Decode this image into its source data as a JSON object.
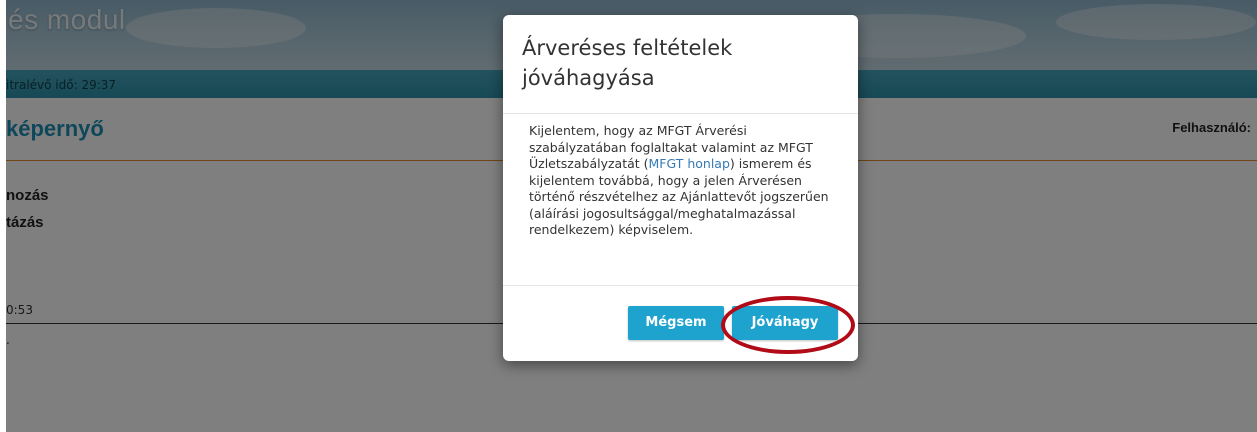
{
  "app": {
    "banner_title": "és modul",
    "timer_text": "itralévő idő: 29:37",
    "page_title": "képernyő",
    "user_label": "Felhasználó:"
  },
  "menu": {
    "items": [
      {
        "label": "nozás"
      },
      {
        "label": "tázás"
      }
    ]
  },
  "lower": {
    "time_text": "0:53",
    "dot_text": "."
  },
  "modal": {
    "title": "Árveréses feltételek jóváhagyása",
    "body_before_link": "Kijelentem, hogy az MFGT Árverési szabályzatában foglaltakat valamint az MFGT Üzletszabályzatát (",
    "link_text": "MFGT honlap",
    "body_after_link": ") ismerem és kijelentem továbbá, hogy a jelen Árverésen történő részvételhez az Ajánlattevőt jogszerűen (aláírási jogosultsággal/meghatalmazással rendelkezem) képviselem.",
    "cancel_label": "Mégsem",
    "approve_label": "Jóváhagy"
  },
  "colors": {
    "accent": "#1ea3cf",
    "highlight": "#b00b16",
    "title_blue": "#1d8fb5",
    "timer_bar": "#2f93ac",
    "divider_orange": "#e38a2b"
  }
}
